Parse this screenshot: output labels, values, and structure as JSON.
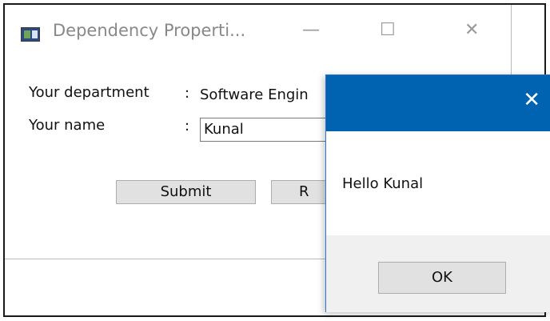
{
  "window": {
    "title": "Dependency Properti...",
    "minimize_glyph": "—",
    "maximize_glyph": "☐",
    "close_glyph": "✕"
  },
  "form": {
    "department_label": "Your department",
    "department_colon": ":",
    "department_value": "Software Engin",
    "name_label": "Your name",
    "name_colon": ":",
    "name_value": "Kunal",
    "submit_label": "Submit",
    "reset_label": "R"
  },
  "dialog": {
    "close_glyph": "✕",
    "message": "Hello Kunal",
    "ok_label": "OK",
    "title_color": "#0063b1"
  }
}
